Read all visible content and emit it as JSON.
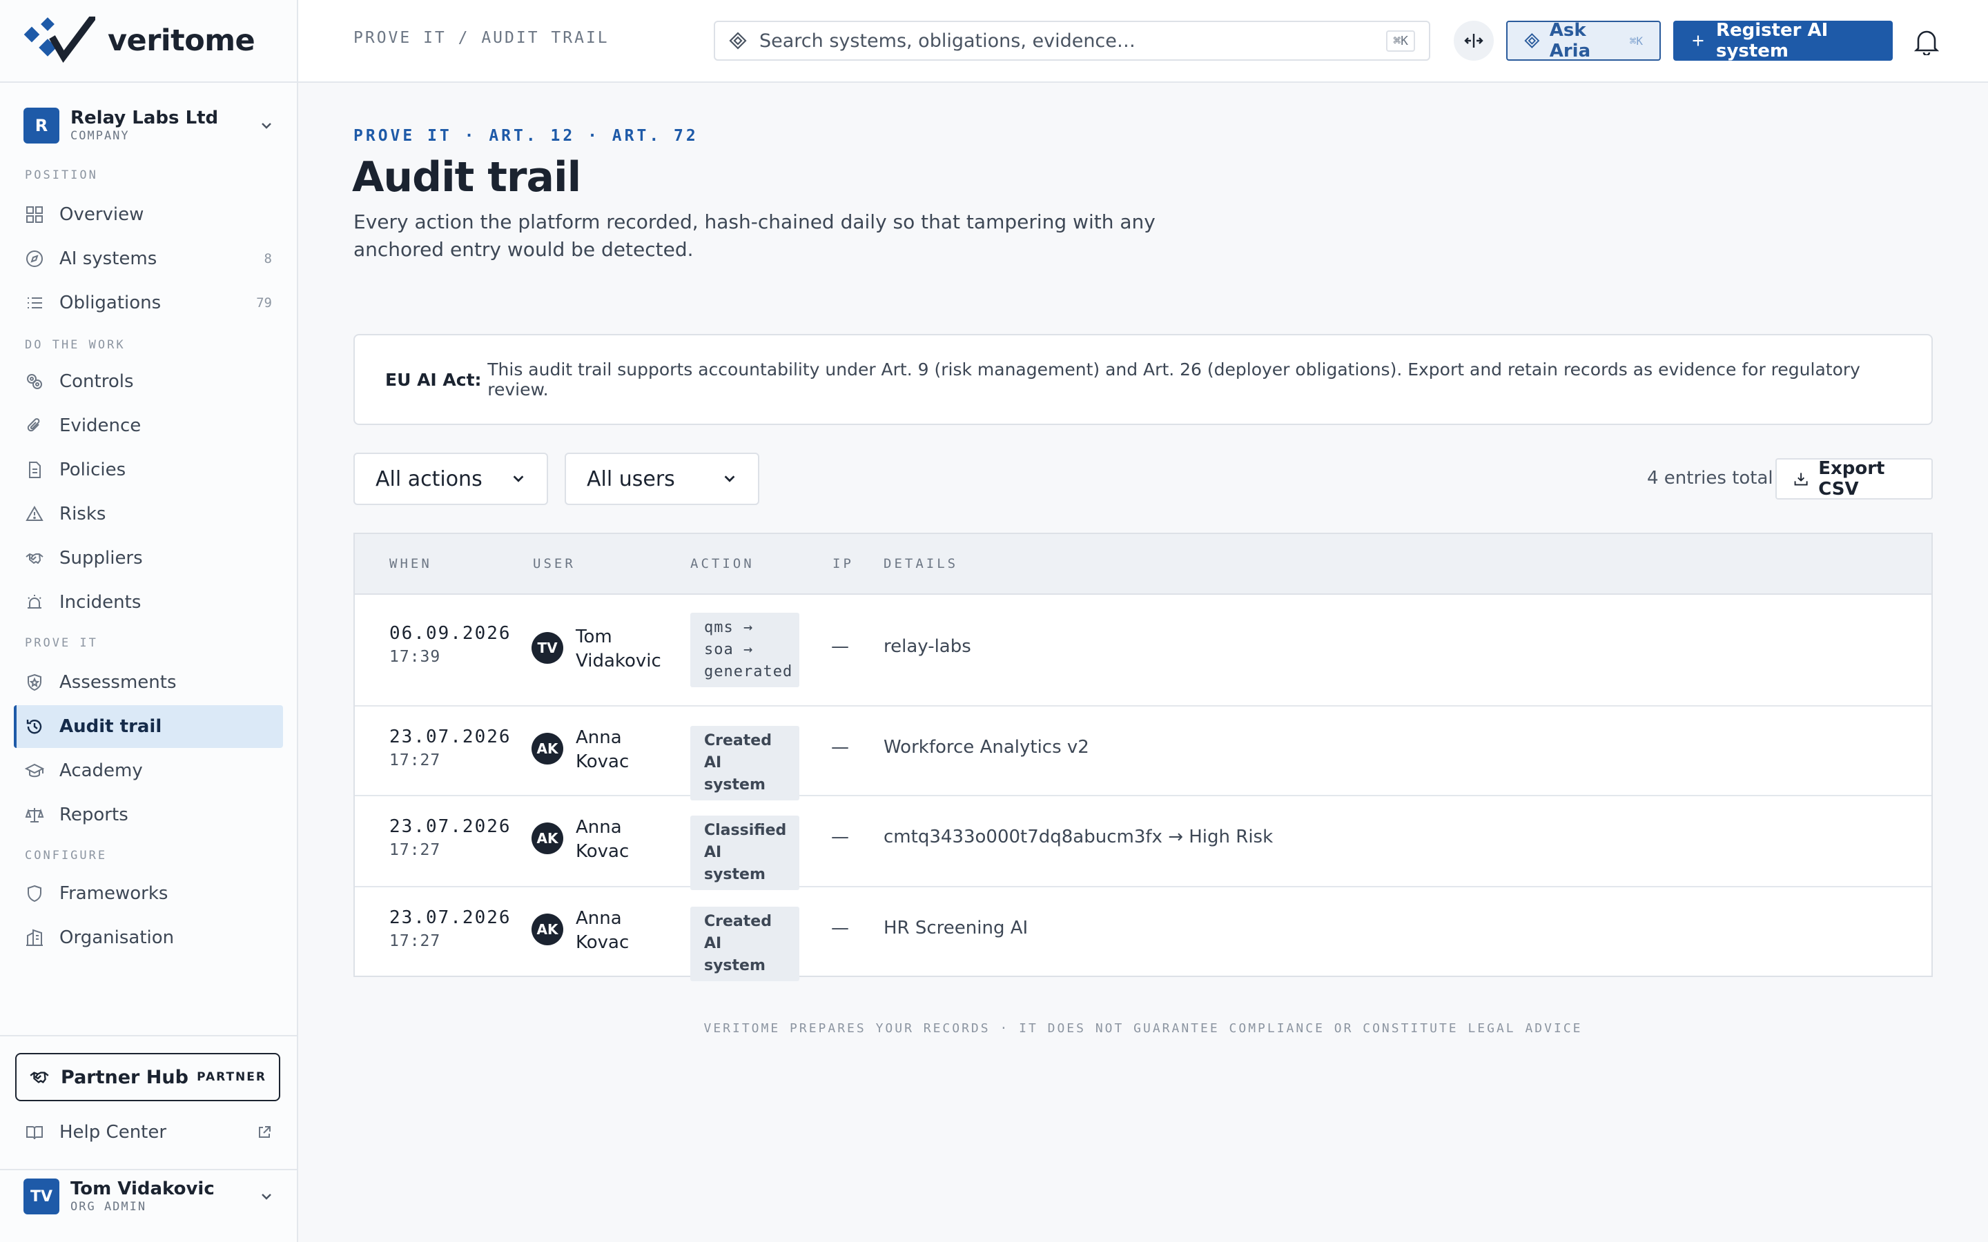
{
  "brand": {
    "name": "veritome"
  },
  "org": {
    "name": "Relay Labs Ltd",
    "type": "COMPANY",
    "initial": "R"
  },
  "sidebar": {
    "sections": {
      "position": "POSITION",
      "work": "DO THE WORK",
      "prove": "PROVE IT",
      "configure": "CONFIGURE"
    },
    "items": {
      "overview": {
        "label": "Overview",
        "icon": "grid-icon"
      },
      "ai_systems": {
        "label": "AI systems",
        "count": "8",
        "icon": "compass-icon"
      },
      "obligations": {
        "label": "Obligations",
        "count": "79",
        "icon": "list-icon"
      },
      "controls": {
        "label": "Controls",
        "icon": "gears-icon"
      },
      "evidence": {
        "label": "Evidence",
        "icon": "paperclip-icon"
      },
      "policies": {
        "label": "Policies",
        "icon": "document-icon"
      },
      "risks": {
        "label": "Risks",
        "icon": "warning-icon"
      },
      "suppliers": {
        "label": "Suppliers",
        "icon": "handshake-icon"
      },
      "incidents": {
        "label": "Incidents",
        "icon": "siren-icon"
      },
      "assessments": {
        "label": "Assessments",
        "icon": "shield-star-icon"
      },
      "audit_trail": {
        "label": "Audit trail",
        "icon": "history-icon",
        "active": true
      },
      "academy": {
        "label": "Academy",
        "icon": "graduation-cap-icon"
      },
      "reports": {
        "label": "Reports",
        "icon": "scales-icon"
      },
      "frameworks": {
        "label": "Frameworks",
        "icon": "shield-icon"
      },
      "organisation": {
        "label": "Organisation",
        "icon": "building-icon"
      }
    },
    "partner": {
      "label": "Partner Hub",
      "tag": "PARTNER"
    },
    "help": {
      "label": "Help Center"
    },
    "user": {
      "name": "Tom Vidakovic",
      "role": "ORG ADMIN",
      "initials": "TV"
    }
  },
  "header": {
    "breadcrumb": "PROVE IT / AUDIT TRAIL",
    "search_placeholder": "Search systems, obligations, evidence…",
    "search_shortcut": "⌘K",
    "ask_aria": "Ask Aria",
    "ask_shortcut": "⌘K",
    "register": "Register AI system"
  },
  "page": {
    "eyebrow": "PROVE IT · ART. 12 · ART. 72",
    "title": "Audit trail",
    "description": "Every action the platform recorded, hash-chained daily so that tampering with any anchored entry would be detected.",
    "notice_strong": "EU AI Act: ",
    "notice_text": "This audit trail supports accountability under Art. 9 (risk management) and Art. 26 (deployer obligations). Export and retain records as evidence for regulatory review."
  },
  "filters": {
    "actions": "All actions",
    "users": "All users",
    "count": "4 entries total",
    "export": "Export CSV"
  },
  "table": {
    "headers": {
      "when": "WHEN",
      "user": "USER",
      "action": "ACTION",
      "ip": "IP",
      "details": "DETAILS"
    },
    "rows": [
      {
        "date": "06.09.2026",
        "time": "17:39",
        "initials": "TV",
        "first": "Tom",
        "last": "Vidakovic",
        "action_lines": [
          "qms →",
          "soa →",
          "generated"
        ],
        "ip": "—",
        "details": "relay-labs"
      },
      {
        "date": "23.07.2026",
        "time": "17:27",
        "initials": "AK",
        "first": "Anna",
        "last": "Kovac",
        "action_lines": [
          "Created",
          "AI system"
        ],
        "ip": "—",
        "details": "Workforce Analytics v2"
      },
      {
        "date": "23.07.2026",
        "time": "17:27",
        "initials": "AK",
        "first": "Anna",
        "last": "Kovac",
        "action_lines": [
          "Classified",
          "AI system"
        ],
        "ip": "—",
        "details": "cmtq3433o000t7dq8abucm3fx → High Risk"
      },
      {
        "date": "23.07.2026",
        "time": "17:27",
        "initials": "AK",
        "first": "Anna",
        "last": "Kovac",
        "action_lines": [
          "Created",
          "AI system"
        ],
        "ip": "—",
        "details": "HR Screening AI"
      }
    ]
  },
  "footer": {
    "note": "VERITOME PREPARES YOUR RECORDS · IT DOES NOT GUARANTEE COMPLIANCE OR CONSTITUTE LEGAL ADVICE"
  },
  "colors": {
    "accent": "#1e5aa8",
    "active_bg": "#dbe9f7",
    "text": "#1b2330"
  }
}
